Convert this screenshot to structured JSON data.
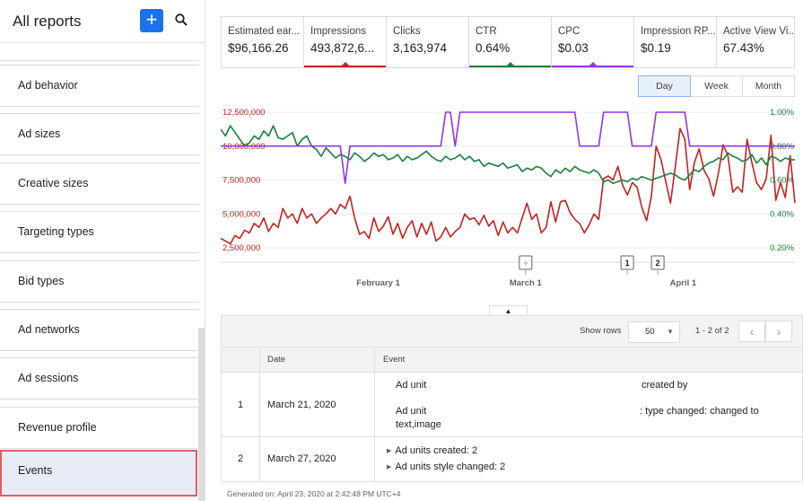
{
  "sidebar": {
    "title": "All reports",
    "add_label": "+",
    "items": [
      {
        "label": "Ad behavior"
      },
      {
        "label": "Ad sizes"
      },
      {
        "label": "Creative sizes"
      },
      {
        "label": "Targeting types"
      },
      {
        "label": "Bid types"
      },
      {
        "label": "Ad networks"
      },
      {
        "label": "Ad sessions"
      },
      {
        "label": "Revenue profile"
      },
      {
        "label": "Events",
        "active": true
      }
    ]
  },
  "metrics": [
    {
      "label": "Estimated ear...",
      "value": "$96,166.26",
      "color": ""
    },
    {
      "label": "Impressions",
      "value": "493,872,6...",
      "color": "#c5221f"
    },
    {
      "label": "Clicks",
      "value": "3,163,974",
      "color": ""
    },
    {
      "label": "CTR",
      "value": "0.64%",
      "color": "#188038"
    },
    {
      "label": "CPC",
      "value": "$0.03",
      "color": "#9334e6"
    },
    {
      "label": "Impression RP...",
      "value": "$0.19",
      "color": ""
    },
    {
      "label": "Active View Vi...",
      "value": "67.43%",
      "color": ""
    }
  ],
  "periods": {
    "day": "Day",
    "week": "Week",
    "month": "Month",
    "active": "day"
  },
  "chart_data": {
    "type": "line",
    "left_axis": {
      "ticks": [
        "12,500,000",
        "10,000,000",
        "7,500,000",
        "5,000,000",
        "2,500,000"
      ],
      "values": [
        12500000,
        10000000,
        7500000,
        5000000,
        2500000
      ],
      "color": "#c5221f"
    },
    "right_axis": {
      "ticks": [
        "1.00%",
        "0.80%",
        "0.60%",
        "0.40%",
        "0.20%"
      ],
      "values": [
        1.0,
        0.8,
        0.6,
        0.4,
        0.2
      ],
      "color": "#188038"
    },
    "x_labels": [
      "February 1",
      "March 1",
      "April 1"
    ],
    "x_label_dates": [
      "2020-02-01",
      "2020-03-01",
      "2020-04-01"
    ],
    "x_range": [
      "2020-01-01",
      "2020-04-23"
    ],
    "grid": true,
    "markers": [
      {
        "label": "+",
        "date": "2020-03-01"
      },
      {
        "label": "1",
        "date": "2020-03-21"
      },
      {
        "label": "2",
        "date": "2020-03-27"
      }
    ],
    "series": [
      {
        "color": "#c5221f",
        "axis": "left",
        "values": [
          3200000,
          3000000,
          2800000,
          3400000,
          3200000,
          3800000,
          3600000,
          4300000,
          4000000,
          4700000,
          3700000,
          4300000,
          4000000,
          5400000,
          4700000,
          5000000,
          4300000,
          5400000,
          4700000,
          5000000,
          4300000,
          4700000,
          5000000,
          5400000,
          5000000,
          5700000,
          5400000,
          6300000,
          4700000,
          3500000,
          3700000,
          3200000,
          4700000,
          3700000,
          4100000,
          4800000,
          3500000,
          4300000,
          3200000,
          4000000,
          4500000,
          3300000,
          4300000,
          3500000,
          4400000,
          3000000,
          3300000,
          4000000,
          3300000,
          3700000,
          4000000,
          5000000,
          4600000,
          4700000,
          4200000,
          4900000,
          4100000,
          4500000,
          3400000,
          4400000,
          3600000,
          4000000,
          3600000,
          4700000,
          5800000,
          4600000,
          5000000,
          3600000,
          4000000,
          5900000,
          4400000,
          5900000,
          6000000,
          5100000,
          4600000,
          4300000,
          3600000,
          4200000,
          5000000,
          4600000,
          7600000,
          7800000,
          7500000,
          8500000,
          7100000,
          6400000,
          7300000,
          7000000,
          5500000,
          4500000,
          6300000,
          10000000,
          9000000,
          7400000,
          5800000,
          8500000,
          11300000,
          10500000,
          6800000,
          8800000,
          9800000,
          8200000,
          7600000,
          6300000,
          8000000,
          10100000,
          9300000,
          6600000,
          7000000,
          6600000,
          10500000,
          8800000,
          7300000,
          6800000,
          7600000,
          10800000,
          6000000,
          7300000,
          6200000,
          9300000,
          5800000
        ]
      },
      {
        "color": "#188038",
        "axis": "right",
        "values": [
          0.9,
          0.86,
          0.92,
          0.88,
          0.84,
          0.8,
          0.82,
          0.86,
          0.84,
          0.89,
          0.86,
          0.92,
          0.85,
          0.84,
          0.86,
          0.88,
          0.8,
          0.84,
          0.86,
          0.8,
          0.78,
          0.74,
          0.79,
          0.76,
          0.73,
          0.75,
          0.74,
          0.72,
          0.76,
          0.74,
          0.71,
          0.73,
          0.76,
          0.74,
          0.75,
          0.72,
          0.73,
          0.75,
          0.71,
          0.74,
          0.72,
          0.73,
          0.75,
          0.77,
          0.74,
          0.72,
          0.71,
          0.74,
          0.72,
          0.73,
          0.75,
          0.72,
          0.74,
          0.71,
          0.72,
          0.68,
          0.7,
          0.69,
          0.68,
          0.7,
          0.67,
          0.68,
          0.69,
          0.65,
          0.67,
          0.66,
          0.68,
          0.67,
          0.64,
          0.62,
          0.66,
          0.64,
          0.67,
          0.65,
          0.68,
          0.66,
          0.65,
          0.64,
          0.66,
          0.64,
          0.59,
          0.6,
          0.58,
          0.59,
          0.6,
          0.59,
          0.61,
          0.6,
          0.62,
          0.61,
          0.6,
          0.61,
          0.62,
          0.63,
          0.64,
          0.63,
          0.61,
          0.6,
          0.63,
          0.66,
          0.65,
          0.68,
          0.7,
          0.71,
          0.73,
          0.72,
          0.76,
          0.74,
          0.73,
          0.71,
          0.72,
          0.75,
          0.7,
          0.73,
          0.69,
          0.74,
          0.73,
          0.71,
          0.73,
          0.72,
          0.72
        ]
      },
      {
        "color": "#9334e6",
        "axis": "right",
        "values": [
          0.8,
          0.8,
          0.8,
          0.8,
          0.8,
          0.8,
          0.8,
          0.8,
          0.8,
          0.8,
          0.8,
          0.8,
          0.8,
          0.8,
          0.8,
          0.8,
          0.8,
          0.8,
          0.8,
          0.8,
          0.8,
          0.8,
          0.8,
          0.8,
          0.8,
          0.8,
          0.58,
          0.8,
          0.8,
          0.8,
          0.8,
          0.8,
          0.8,
          0.8,
          0.8,
          0.8,
          0.8,
          0.8,
          0.8,
          0.8,
          0.8,
          0.8,
          0.8,
          0.8,
          0.8,
          0.8,
          0.8,
          1.0,
          1.0,
          0.8,
          1.0,
          1.0,
          1.0,
          1.0,
          1.0,
          1.0,
          1.0,
          1.0,
          1.0,
          1.0,
          1.0,
          1.0,
          1.0,
          1.0,
          1.0,
          1.0,
          1.0,
          1.0,
          1.0,
          1.0,
          1.0,
          1.0,
          1.0,
          1.0,
          1.0,
          0.8,
          0.8,
          0.8,
          0.8,
          0.8,
          1.0,
          1.0,
          1.0,
          1.0,
          1.0,
          1.0,
          0.8,
          0.8,
          0.8,
          0.8,
          0.8,
          1.0,
          1.0,
          1.0,
          1.0,
          1.0,
          1.0,
          1.0,
          0.8,
          0.8,
          0.8,
          0.8,
          0.8,
          0.8,
          0.8,
          0.8,
          0.8,
          0.8,
          0.8,
          0.8,
          0.8,
          0.8,
          0.8,
          0.8,
          0.8,
          0.8,
          0.8,
          0.8,
          0.8,
          0.8,
          0.8
        ]
      }
    ]
  },
  "table": {
    "show_rows_label": "Show rows",
    "show_rows_value": "50",
    "range_label": "1 - 2 of 2",
    "prev_label": "‹",
    "next_label": "›",
    "headers": {
      "date": "Date",
      "event": "Event"
    },
    "rows": [
      {
        "num": "1",
        "date": "March 21, 2020",
        "lines": [
          {
            "left": "Ad unit",
            "right": "created by"
          },
          {
            "left": "Ad unit",
            "left2": "text,image",
            "right": ": type changed: changed to"
          }
        ]
      },
      {
        "num": "2",
        "date": "March 27, 2020",
        "lines": [
          {
            "left": "Ad units created: 2"
          },
          {
            "left": "Ad units style changed: 2"
          }
        ]
      }
    ]
  },
  "footer": "Generated on: April 23, 2020 at 2:42:48 PM UTC+4"
}
